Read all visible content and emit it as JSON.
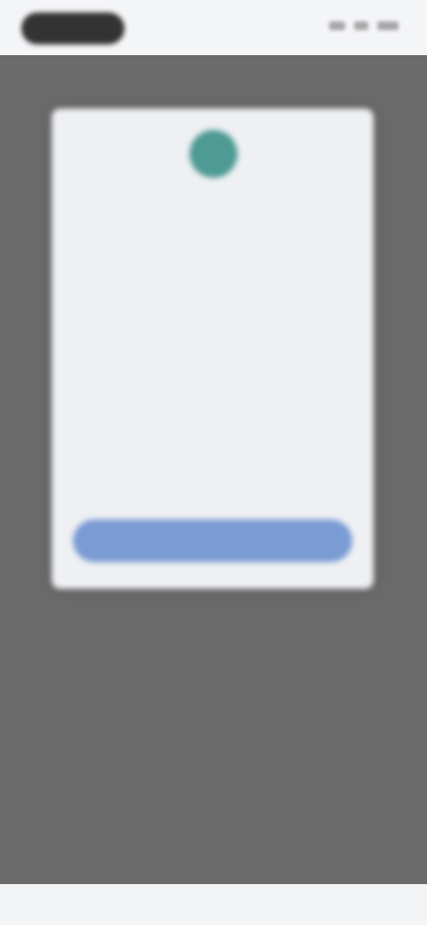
{
  "colors": {
    "overlay": "#6b6b6b",
    "modal_bg": "#eef0f3",
    "icon": "#4e9a94",
    "button": "#7b9bd4",
    "status_bar": "#f4f5f7",
    "bottom_bar": "#f3f4f6"
  },
  "modal": {
    "icon_name": "app-logo-icon",
    "title": "",
    "paragraphs": [
      "",
      "",
      ""
    ],
    "button_label": ""
  }
}
